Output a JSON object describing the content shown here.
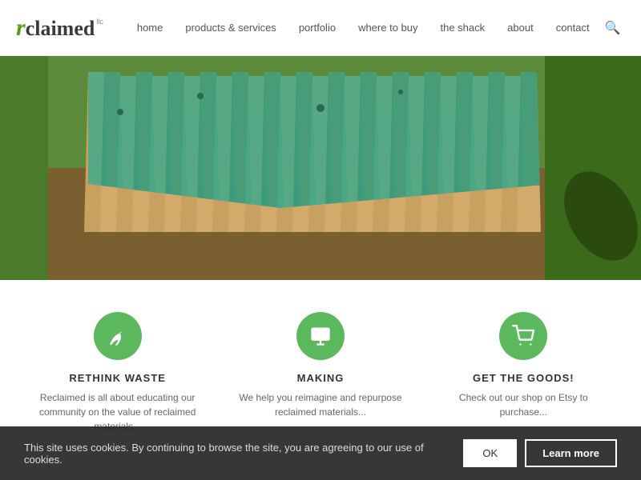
{
  "header": {
    "logo_r": "r",
    "logo_claimed": "claimed",
    "logo_llc": "llc",
    "nav": {
      "home": "home",
      "products": "products & services",
      "portfolio": "portfolio",
      "where_to_buy": "where to buy",
      "the_shack": "the shack",
      "about": "about",
      "contact": "contact"
    }
  },
  "cards": [
    {
      "icon": "leaf",
      "title": "RETHINK WASTE",
      "text": "Reclaimed is all about educating our community on the value of reclaimed materials..."
    },
    {
      "icon": "monitor",
      "title": "MAKING",
      "text": "We help you reimagine and repurpose reclaimed materials..."
    },
    {
      "icon": "cart",
      "title": "GET THE GOODS!",
      "text": "Check out our shop on Etsy to purchase..."
    }
  ],
  "cookie": {
    "message": "This site uses cookies. By continuing to browse the site, you are agreeing to our use of cookies.",
    "ok_label": "OK",
    "learn_label": "Learn more"
  }
}
